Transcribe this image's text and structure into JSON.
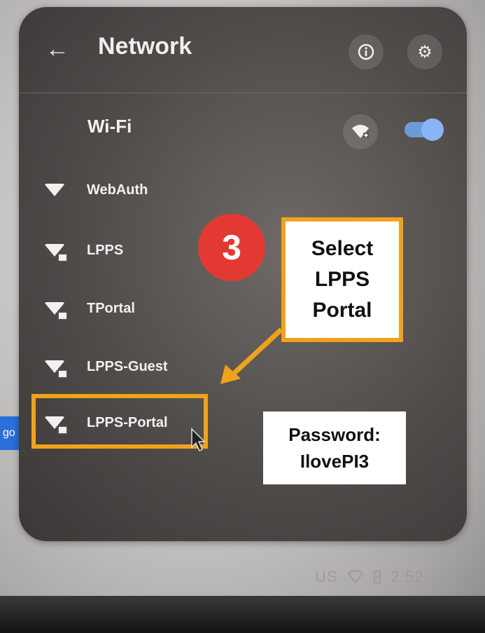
{
  "header": {
    "title": "Network",
    "back_icon": "arrow-left-icon",
    "info_icon": "info-icon",
    "settings_icon": "gear-icon"
  },
  "wifi": {
    "section_title": "Wi-Fi",
    "add_network_icon": "wifi-add-icon",
    "enabled": true,
    "networks": [
      {
        "name": "WebAuth",
        "secured": false
      },
      {
        "name": "LPPS",
        "secured": true
      },
      {
        "name": "TPortal",
        "secured": true
      },
      {
        "name": "LPPS-Guest",
        "secured": true
      },
      {
        "name": "LPPS-Portal",
        "secured": true
      }
    ]
  },
  "annotations": {
    "step_number": "3",
    "callout_text": "Select\nLPPS\nPortal",
    "password_note": "Password:\nIlovePI3",
    "accent_color": "#f0a21d",
    "badge_color": "#e23a33"
  },
  "status_tray": {
    "keyboard_layout": "US",
    "time": "2:52"
  },
  "background_chip": {
    "text": "go"
  }
}
